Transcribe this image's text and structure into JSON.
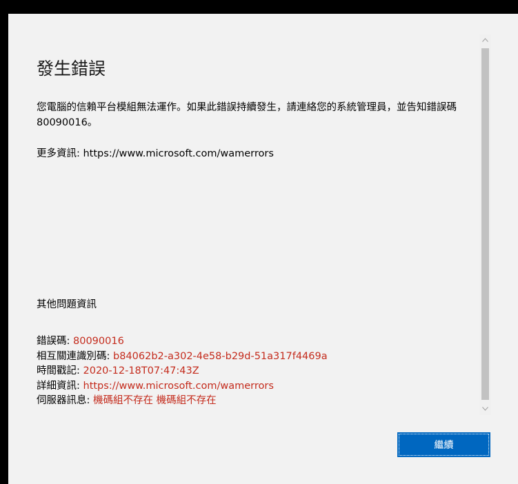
{
  "dialog": {
    "title": "發生錯誤",
    "message": "您電腦的信賴平台模組無法運作。如果此錯誤持續發生，請連絡您的系統管理員，並告知錯誤碼 80090016。",
    "more_info": "更多資訊: https://www.microsoft.com/wamerrors",
    "additional_heading": "其他問題資訊",
    "details": [
      {
        "label": "錯誤碼: ",
        "value": "80090016"
      },
      {
        "label": "相互關連識別碼: ",
        "value": "b84062b2-a302-4e58-b29d-51a317f4469a"
      },
      {
        "label": "時間戳記: ",
        "value": "2020-12-18T07:47:43Z"
      },
      {
        "label": "詳細資訊: ",
        "value": "https://www.microsoft.com/wamerrors"
      },
      {
        "label": "伺服器訊息: ",
        "value": "機碼組不存在 機碼組不存在"
      }
    ],
    "continue_label": "繼續"
  },
  "icons": {
    "scroll_up": "chevron-up-icon",
    "scroll_down": "chevron-down-icon"
  },
  "colors": {
    "accent": "#0067c0",
    "value_red": "#c42b1c",
    "background": "#f2f2f2"
  }
}
